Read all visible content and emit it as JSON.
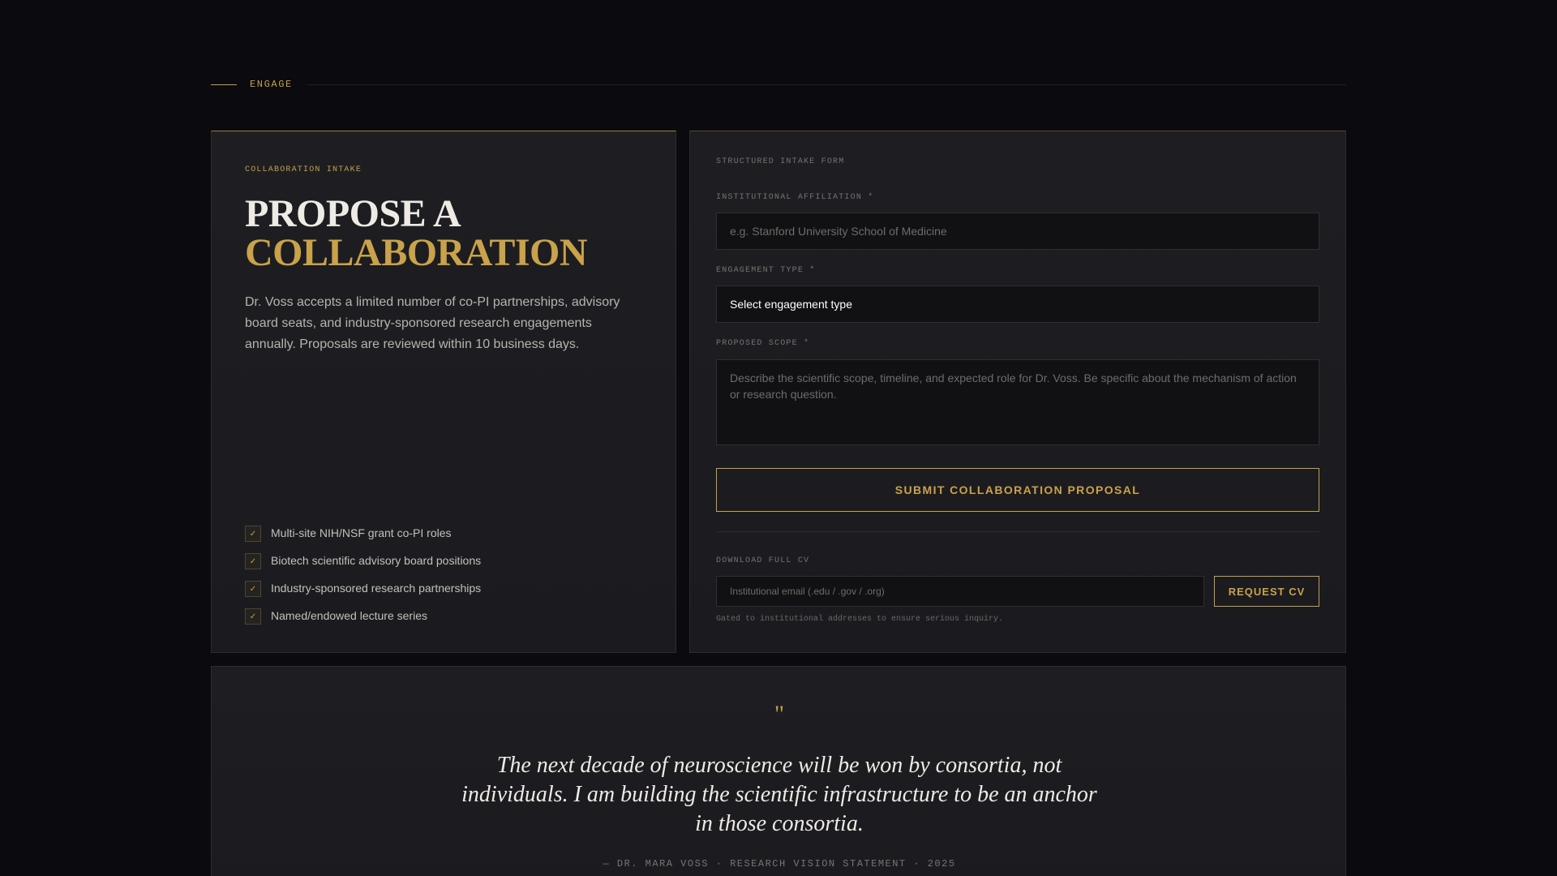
{
  "section": {
    "label": "ENGAGE"
  },
  "intake": {
    "eyebrow": "COLLABORATION INTAKE",
    "headline_line1": "PROPOSE A",
    "headline_line2": "COLLABORATION",
    "intro": "Dr. Voss accepts a limited number of co-PI partnerships, advisory board seats, and industry-sponsored research engagements annually. Proposals are reviewed within 10 business days.",
    "checkmark": "✓",
    "items": [
      "Multi-site NIH/NSF grant co-PI roles",
      "Biotech scientific advisory board positions",
      "Industry-sponsored research partnerships",
      "Named/endowed lecture series"
    ]
  },
  "form": {
    "eyebrow": "STRUCTURED INTAKE FORM",
    "affiliation_label": "INSTITUTIONAL AFFILIATION *",
    "affiliation_placeholder": "e.g. Stanford University School of Medicine",
    "engagement_label": "ENGAGEMENT TYPE *",
    "engagement_value": "Select engagement type",
    "scope_label": "PROPOSED SCOPE *",
    "scope_placeholder": "Describe the scientific scope, timeline, and expected role for Dr. Voss. Be specific about the mechanism of action or research question.",
    "submit_label": "SUBMIT COLLABORATION PROPOSAL",
    "cv_label": "DOWNLOAD FULL CV",
    "email_placeholder": "Institutional email (.edu / .gov / .org)",
    "request_label": "REQUEST CV",
    "note": "Gated to institutional addresses to ensure serious inquiry."
  },
  "quote": {
    "mark": "\"",
    "text": "The next decade of neuroscience will be won by consortia, not individuals. I am building the scientific infrastructure to be an anchor in those consortia.",
    "attribution": "— DR. MARA VOSS · RESEARCH VISION STATEMENT · 2025"
  },
  "colors": {
    "accent": "#c4a04a",
    "background": "#0b0b0f",
    "card": "#1e1e22"
  }
}
